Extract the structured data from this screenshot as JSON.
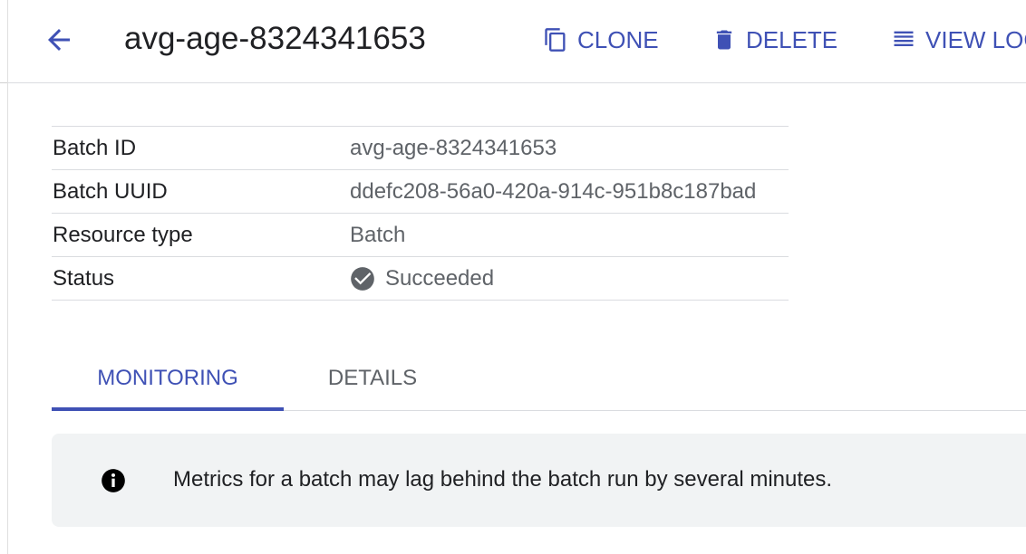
{
  "header": {
    "title": "avg-age-8324341653",
    "back_icon": "arrow-back-icon",
    "actions": [
      {
        "label": "CLONE",
        "icon": "content-copy-icon"
      },
      {
        "label": "DELETE",
        "icon": "trash-icon"
      },
      {
        "label": "VIEW LOG",
        "icon": "list-icon"
      }
    ]
  },
  "properties": [
    {
      "key": "Batch ID",
      "value": "avg-age-8324341653"
    },
    {
      "key": "Batch UUID",
      "value": "ddefc208-56a0-420a-914c-951b8c187bad"
    },
    {
      "key": "Resource type",
      "value": "Batch"
    },
    {
      "key": "Status",
      "value": "Succeeded",
      "icon": "check-circle-icon"
    }
  ],
  "tabs": [
    {
      "label": "MONITORING",
      "active": true
    },
    {
      "label": "DETAILS",
      "active": false
    }
  ],
  "banner": {
    "icon": "info-icon",
    "message": "Metrics for a batch may lag behind the batch run by several minutes."
  },
  "colors": {
    "accent": "#3f51b5",
    "text": "#202124",
    "muted": "#5f6368",
    "divider": "#dadce0",
    "banner_bg": "#f1f3f4",
    "success_icon": "#5f6368"
  }
}
